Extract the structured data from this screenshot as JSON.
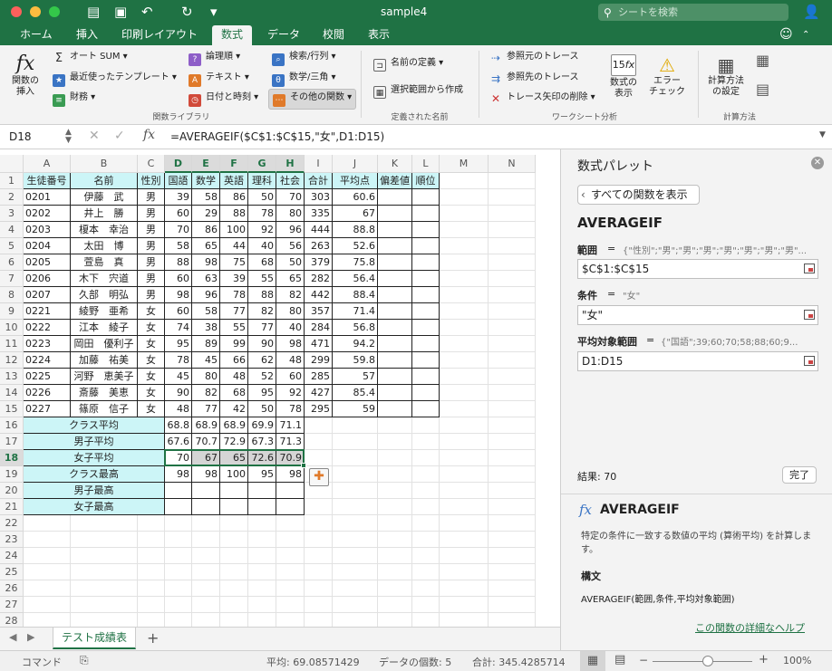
{
  "window": {
    "title": "sample4",
    "search_placeholder": "シートを検索"
  },
  "tabs": [
    "ホーム",
    "挿入",
    "印刷レイアウト",
    "数式",
    "データ",
    "校閲",
    "表示"
  ],
  "ribbon": {
    "insert_function": "関数の\n挿入",
    "autosum": "オート SUM",
    "recent": "最近使ったテンプレート",
    "financial": "財務",
    "logical": "論理順",
    "text": "テキスト",
    "datetime": "日付と時刻",
    "lookup": "検索/行列",
    "math": "数学/三角",
    "more": "その他の関数",
    "group_library": "関数ライブラリ",
    "define_name": "名前の定義",
    "create_from_selection": "選択範囲から作成",
    "group_names": "定義された名前",
    "trace_precedents": "参照元のトレース",
    "trace_dependents": "参照先のトレース",
    "remove_arrows": "トレース矢印の削除",
    "show_formulas": "数式の\n表示",
    "error_check": "エラー\nチェック",
    "group_audit": "ワークシート分析",
    "calc_options": "計算方法\nの設定",
    "group_calc": "計算方法"
  },
  "formula_bar": {
    "name_box": "D18",
    "formula": "=AVERAGEIF($C$1:$C$15,\"女\",D1:D15)",
    "fx": "fx"
  },
  "columns": [
    "A",
    "B",
    "C",
    "D",
    "E",
    "F",
    "G",
    "H",
    "I",
    "J",
    "K",
    "L",
    "M",
    "N"
  ],
  "rows": [
    [
      "生徒番号",
      "名前",
      "性別",
      "国語",
      "数学",
      "英語",
      "理科",
      "社会",
      "合計",
      "平均点",
      "偏差値",
      "順位"
    ],
    [
      "0201",
      "伊藤　武",
      "男",
      "39",
      "58",
      "86",
      "50",
      "70",
      "303",
      "60.6",
      "",
      ""
    ],
    [
      "0202",
      "井上　勝",
      "男",
      "60",
      "29",
      "88",
      "78",
      "80",
      "335",
      "67",
      "",
      ""
    ],
    [
      "0203",
      "榎本　幸治",
      "男",
      "70",
      "86",
      "100",
      "92",
      "96",
      "444",
      "88.8",
      "",
      ""
    ],
    [
      "0204",
      "太田　博",
      "男",
      "58",
      "65",
      "44",
      "40",
      "56",
      "263",
      "52.6",
      "",
      ""
    ],
    [
      "0205",
      "萱島　真",
      "男",
      "88",
      "98",
      "75",
      "68",
      "50",
      "379",
      "75.8",
      "",
      ""
    ],
    [
      "0206",
      "木下　宍道",
      "男",
      "60",
      "63",
      "39",
      "55",
      "65",
      "282",
      "56.4",
      "",
      ""
    ],
    [
      "0207",
      "久部　明弘",
      "男",
      "98",
      "96",
      "78",
      "88",
      "82",
      "442",
      "88.4",
      "",
      ""
    ],
    [
      "0221",
      "綾野　亜希",
      "女",
      "60",
      "58",
      "77",
      "82",
      "80",
      "357",
      "71.4",
      "",
      ""
    ],
    [
      "0222",
      "江本　綾子",
      "女",
      "74",
      "38",
      "55",
      "77",
      "40",
      "284",
      "56.8",
      "",
      ""
    ],
    [
      "0223",
      "岡田　優利子",
      "女",
      "95",
      "89",
      "99",
      "90",
      "98",
      "471",
      "94.2",
      "",
      ""
    ],
    [
      "0224",
      "加藤　祐美",
      "女",
      "78",
      "45",
      "66",
      "62",
      "48",
      "299",
      "59.8",
      "",
      ""
    ],
    [
      "0225",
      "河野　恵美子",
      "女",
      "45",
      "80",
      "48",
      "52",
      "60",
      "285",
      "57",
      "",
      ""
    ],
    [
      "0226",
      "斎藤　美恵",
      "女",
      "90",
      "82",
      "68",
      "95",
      "92",
      "427",
      "85.4",
      "",
      ""
    ],
    [
      "0227",
      "篠原　信子",
      "女",
      "48",
      "77",
      "42",
      "50",
      "78",
      "295",
      "59",
      "",
      ""
    ]
  ],
  "summary": [
    {
      "label": "クラス平均",
      "values": [
        "68.8",
        "68.9",
        "68.9",
        "69.9",
        "71.1"
      ]
    },
    {
      "label": "男子平均",
      "values": [
        "67.6",
        "70.7",
        "72.9",
        "67.3",
        "71.3"
      ]
    },
    {
      "label": "女子平均",
      "values": [
        "70",
        "67",
        "65",
        "72.6",
        "70.9"
      ]
    },
    {
      "label": "クラス最高",
      "values": [
        "98",
        "98",
        "100",
        "95",
        "98"
      ]
    },
    {
      "label": "男子最高",
      "values": [
        "",
        "",
        "",
        "",
        ""
      ]
    },
    {
      "label": "女子最高",
      "values": [
        "",
        "",
        "",
        "",
        ""
      ]
    }
  ],
  "sheet": {
    "tab": "テスト成績表",
    "add": "+"
  },
  "status": {
    "mode": "コマンド",
    "average": "平均: 69.08571429",
    "count": "データの個数: 5",
    "sum": "合計: 345.4285714",
    "zoom": "100%"
  },
  "pane": {
    "title": "数式パレット",
    "show_all": "すべての関数を表示",
    "func_name": "AVERAGEIF",
    "arg1_label": "範囲",
    "arg1_eq": "=",
    "arg1_preview": "{\"性別\";\"男\";\"男\";\"男\";\"男\";\"男\";\"男\";\"男\"...",
    "arg1_value": "$C$1:$C$15",
    "arg2_label": "条件",
    "arg2_eq": "=",
    "arg2_preview": "\"女\"",
    "arg2_value": "\"女\"",
    "arg3_label": "平均対象範囲",
    "arg3_eq": "=",
    "arg3_preview": "{\"国語\";39;60;70;58;88;60;9...",
    "arg3_value": "D1:D15",
    "result": "結果: 70",
    "done": "完了",
    "desc_title": "AVERAGEIF",
    "desc": "特定の条件に一致する数値の平均 (算術平均) を計算します。",
    "syntax_label": "構文",
    "syntax": "AVERAGEIF(範囲,条件,平均対象範囲)",
    "help": "この関数の詳細なヘルプ"
  }
}
